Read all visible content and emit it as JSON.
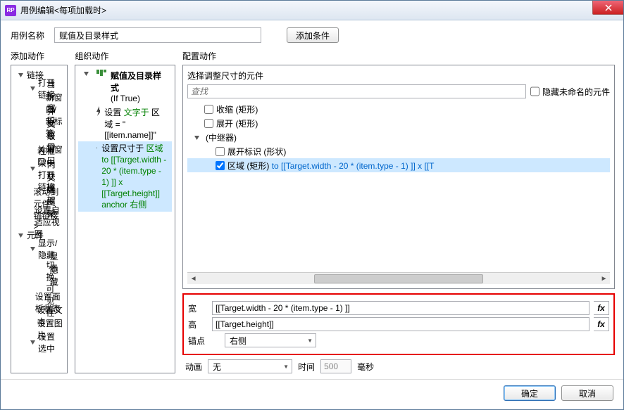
{
  "window": {
    "title": "用例编辑<每项加载时>"
  },
  "toolbar": {
    "name_label": "用例名称",
    "name_value": "赋值及目录样式",
    "add_condition": "添加条件"
  },
  "columns": {
    "add_action": "添加动作",
    "organize_action": "组织动作",
    "configure_action": "配置动作"
  },
  "add_actions": {
    "items": [
      {
        "label": "链接",
        "level": 0,
        "expand": true
      },
      {
        "label": "打开链接",
        "level": 1,
        "expand": true
      },
      {
        "label": "当前窗口",
        "level": 2
      },
      {
        "label": "新窗口/新标签",
        "level": 2
      },
      {
        "label": "弹出窗口",
        "level": 2
      },
      {
        "label": "父级窗口",
        "level": 2
      },
      {
        "label": "关闭窗口",
        "level": 1
      },
      {
        "label": "在框架中打开链接",
        "level": 1,
        "expand": true
      },
      {
        "label": "内联框架",
        "level": 2
      },
      {
        "label": "父级框架",
        "level": 2
      },
      {
        "label": "滚动到元件<锚链接>",
        "level": 1
      },
      {
        "label": "设置自适应视图",
        "level": 1
      },
      {
        "label": "元件",
        "level": 0,
        "expand": true
      },
      {
        "label": "显示/隐藏",
        "level": 1,
        "expand": true
      },
      {
        "label": "显示",
        "level": 2
      },
      {
        "label": "隐藏",
        "level": 2
      },
      {
        "label": "切换可见性",
        "level": 2
      },
      {
        "label": "设置面板状态",
        "level": 1
      },
      {
        "label": "设置文本",
        "level": 1
      },
      {
        "label": "设置图片",
        "level": 1
      },
      {
        "label": "设置选中",
        "level": 1,
        "expand": true
      }
    ]
  },
  "organize": {
    "case_name": "赋值及目录样式",
    "case_cond": "(If True)",
    "row1_pre": "设置 ",
    "row1_green": "文字于",
    "row1_rest": " 区域 = \"[[item.name]]\"",
    "row2_pre": "设置尺寸于 ",
    "row2_rest": "区域 to [[Target.width - 20 * (item.type - 1) ]] x [[Target.height]] anchor 右侧"
  },
  "configure": {
    "subtitle": "选择调整尺寸的元件",
    "search_placeholder": "查找",
    "hide_unnamed": "隐藏未命名的元件",
    "opt_collapse": "收缩 (矩形)",
    "opt_expand": "展开 (矩形)",
    "group": "(中继器)",
    "child1": "展开标识 (形状)",
    "child2_label": "区域 (矩形) ",
    "child2_expr": "to [[Target.width - 20 * (item.type - 1) ]] x [[T",
    "width_label": "宽",
    "width_value": "[[Target.width - 20 * (item.type - 1) ]]",
    "height_label": "高",
    "height_value": "[[Target.height]]",
    "fx": "fx",
    "anchor_label": "锚点",
    "anchor_value": "右侧",
    "anim_label": "动画",
    "anim_value": "无",
    "time_label": "时间",
    "time_value": "500",
    "time_unit": "毫秒"
  },
  "buttons": {
    "ok": "确定",
    "cancel": "取消"
  },
  "chart_data": null
}
